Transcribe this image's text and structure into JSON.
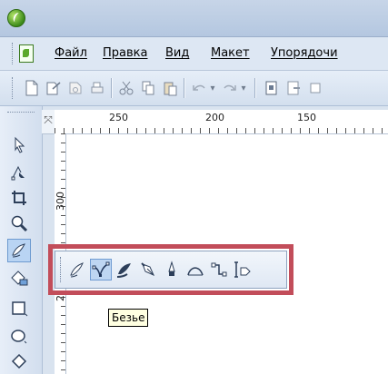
{
  "menu": {
    "items": [
      "Файл",
      "Правка",
      "Вид",
      "Макет",
      "Упорядочи"
    ]
  },
  "ruler": {
    "horizontal_labels": [
      "250",
      "200",
      "150"
    ],
    "vertical_labels": [
      "300",
      "2"
    ],
    "corner_symbol": "⤧"
  },
  "toolbar": {
    "icons": [
      "new-icon",
      "open-icon",
      "save-icon",
      "print-icon",
      "cut-icon",
      "copy-icon",
      "paste-icon",
      "undo-icon",
      "redo-icon",
      "import-icon",
      "export-icon",
      "zoom-icon"
    ]
  },
  "toolbox": {
    "tools": [
      "pick-tool",
      "shape-tool",
      "crop-tool",
      "zoom-tool",
      "curve-tool",
      "fill-tool",
      "rectangle-tool",
      "ellipse-tool",
      "polygon-tool"
    ],
    "selected": "curve-tool"
  },
  "flyout": {
    "tools": [
      "freehand-tool",
      "bezier-tool",
      "artistic-media-tool",
      "pen-tool",
      "polyline-tool",
      "3-point-curve-tool",
      "connector-tool",
      "dimension-tool"
    ],
    "active": "bezier-tool"
  },
  "tooltip": {
    "text": "Безье"
  },
  "colors": {
    "highlight_border": "#c24d5a",
    "chrome": "#d9e3ef",
    "selected_bg": "#bed6f2"
  }
}
